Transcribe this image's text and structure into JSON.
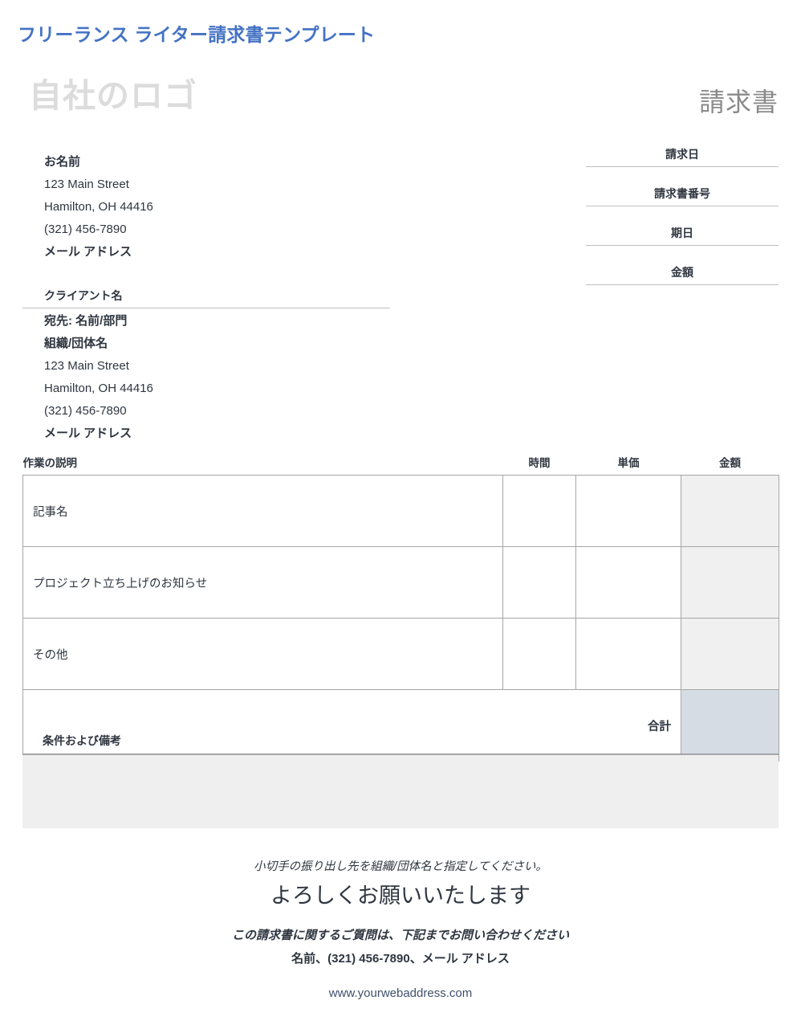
{
  "document": {
    "template_title": "フリーランス ライター請求書テンプレート",
    "logo_placeholder": "自社のロゴ",
    "invoice_word": "請求書"
  },
  "sender": {
    "lines": [
      {
        "text": "お名前",
        "bold": true
      },
      {
        "text": "123 Main Street",
        "bold": false
      },
      {
        "text": "Hamilton, OH 44416",
        "bold": false
      },
      {
        "text": "(321) 456-7890",
        "bold": false
      },
      {
        "text": "メール アドレス",
        "bold": true
      }
    ]
  },
  "client": {
    "label": "クライアント名",
    "lines": [
      {
        "text": "宛先: 名前/部門",
        "bold": true
      },
      {
        "text": "組織/団体名",
        "bold": true
      },
      {
        "text": "123 Main Street",
        "bold": false
      },
      {
        "text": "Hamilton, OH 44416",
        "bold": false
      },
      {
        "text": "(321) 456-7890",
        "bold": false
      },
      {
        "text": "メール アドレス",
        "bold": true
      }
    ]
  },
  "meta_fields": [
    {
      "label": "請求日",
      "value": ""
    },
    {
      "label": "請求書番号",
      "value": ""
    },
    {
      "label": "期日",
      "value": ""
    },
    {
      "label": "金額",
      "value": ""
    }
  ],
  "items_table": {
    "headers": {
      "description": "作業の説明",
      "hours": "時間",
      "rate": "単価",
      "amount": "金額"
    },
    "rows": [
      {
        "description": "記事名",
        "hours": "",
        "rate": "",
        "amount": ""
      },
      {
        "description": "プロジェクト立ち上げのお知らせ",
        "hours": "",
        "rate": "",
        "amount": ""
      },
      {
        "description": "その他",
        "hours": "",
        "rate": "",
        "amount": ""
      }
    ],
    "total_label": "合計",
    "total_value": ""
  },
  "notes": {
    "label": "条件および備考",
    "value": ""
  },
  "footer": {
    "check_instruction": "小切手の振り出し先を組織/団体名と指定してください。",
    "thanks": "よろしくお願いいたします",
    "questions": "この請求書に関するご質問は、下記までお問い合わせください",
    "contact": "名前、(321) 456-7890、メール アドレス",
    "website": "www.yourwebaddress.com"
  },
  "colors": {
    "title_blue": "#4472c4",
    "logo_gray": "#dcdcdc",
    "invoice_word_gray": "#8a8a8a",
    "text_dark": "#2f3640",
    "rule_gray": "#bfbfbf",
    "table_border": "#a6a6a6",
    "amount_col_fill": "#f0f0f0",
    "total_fill": "#d6dce4",
    "notes_fill": "#efefef",
    "web_link": "#41506b"
  }
}
